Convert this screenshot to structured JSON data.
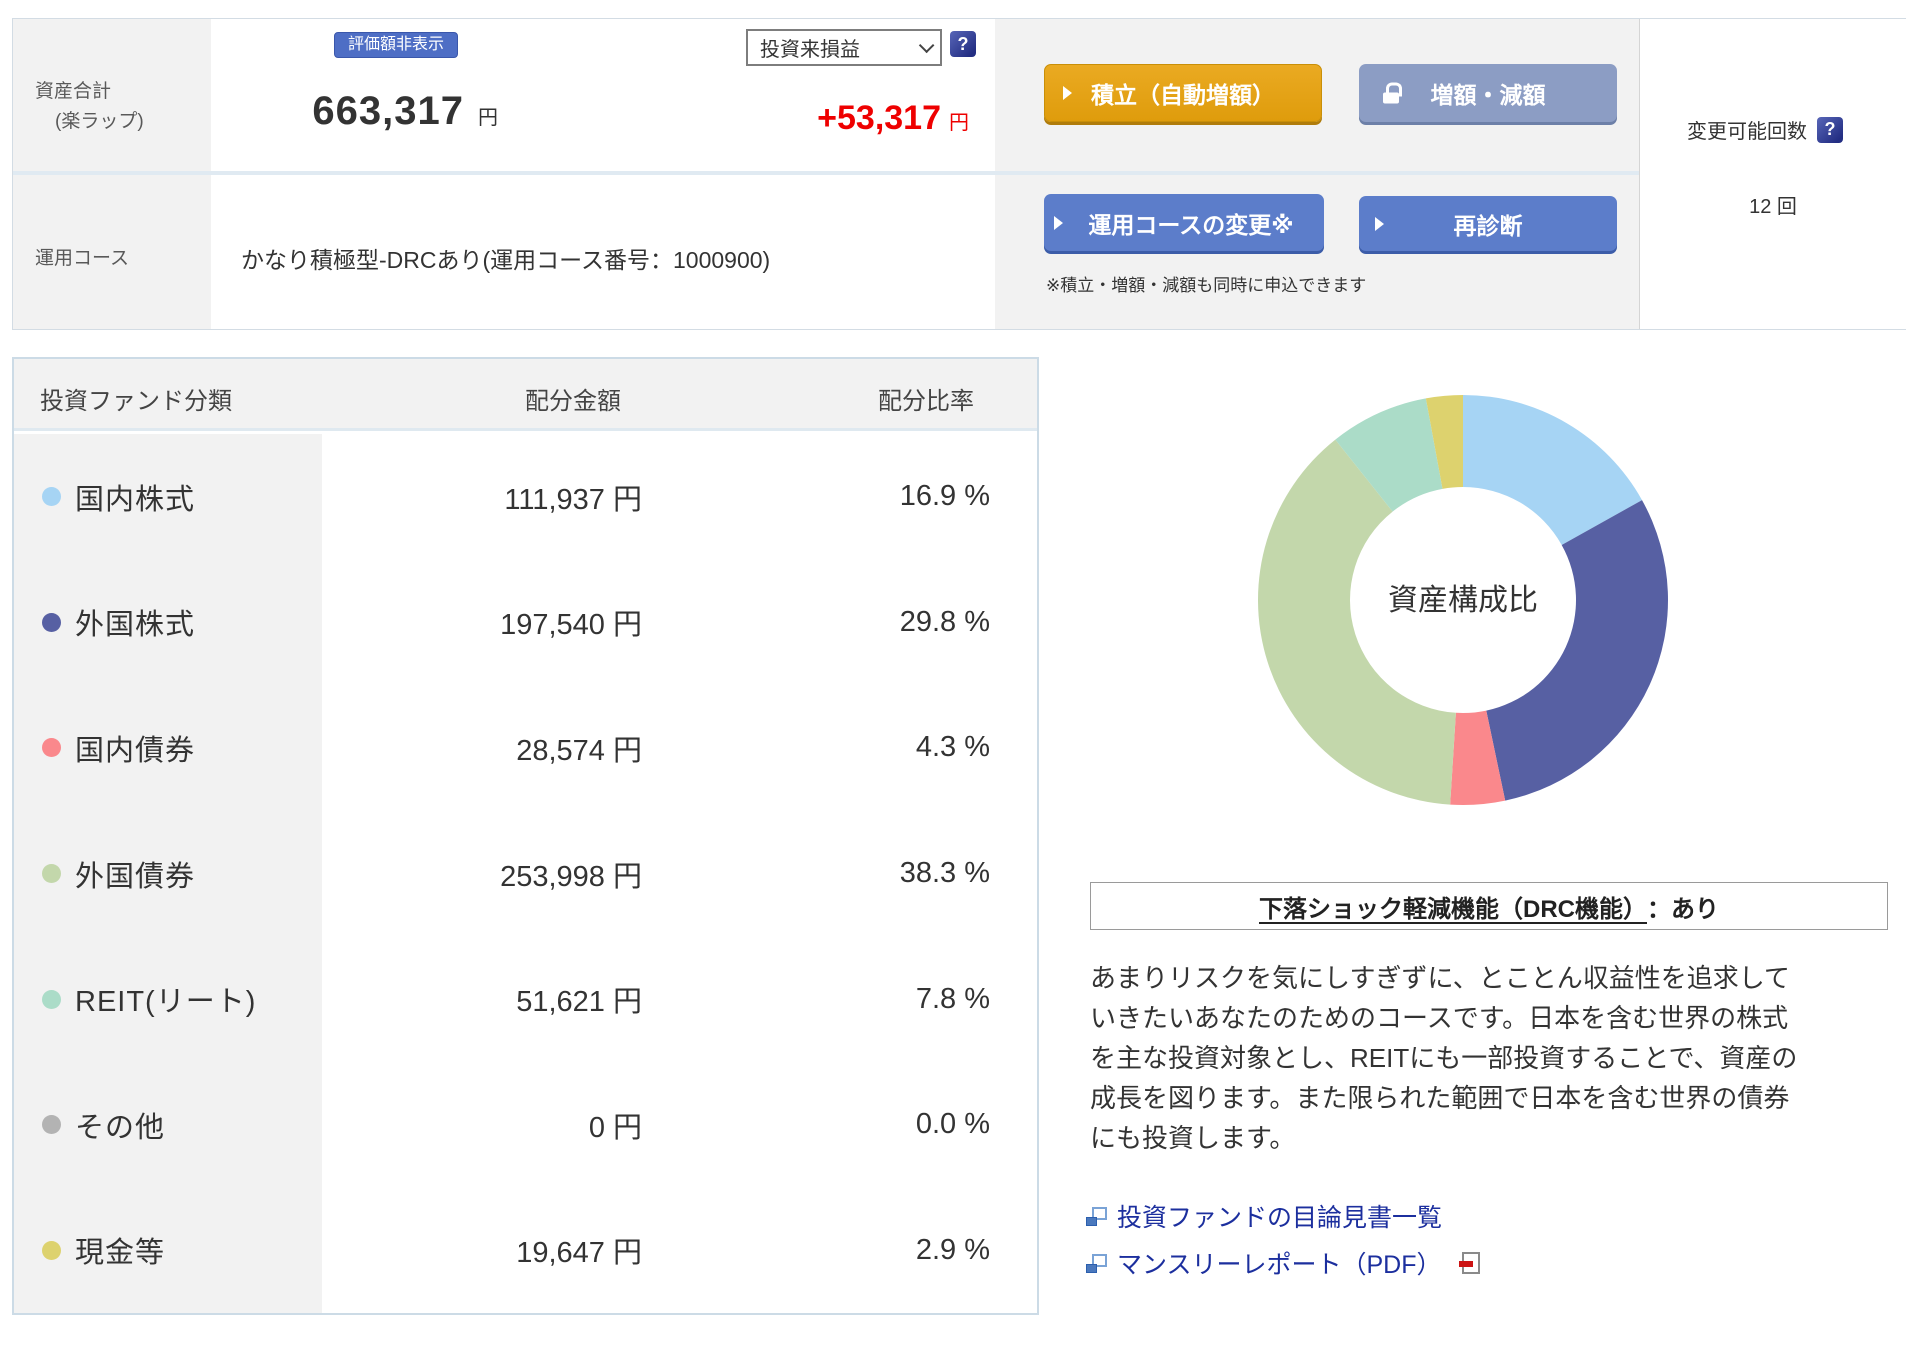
{
  "header": {
    "asset_total_label_line1": "資産合計",
    "asset_total_label_line2": "(楽ラップ)",
    "hide_value_button": "評価額非表示",
    "total_amount": "663,317",
    "total_unit": "円",
    "pl_dropdown_value": "投資来損益",
    "pl_amount": "+53,317",
    "pl_unit": "円",
    "help_icon_glyph": "?",
    "tsumitate_button": "積立（自動増額）",
    "zougaku_button": "増額・減額",
    "course_label": "運用コース",
    "course_value": "かなり積極型-DRCあり(運用コース番号：1000900)",
    "course_change_button": "運用コースの変更※",
    "rediagnosis_button": "再診断",
    "note": "※積立・増額・減額も同時に申込できます",
    "change_count_label": "変更可能回数",
    "change_count_value": "12 回"
  },
  "table": {
    "headers": {
      "category": "投資ファンド分類",
      "amount": "配分金額",
      "ratio": "配分比率"
    },
    "rows": [
      {
        "label": "国内株式",
        "amount": "111,937 円",
        "percent": "16.9 %",
        "color": "#a6d4f4"
      },
      {
        "label": "外国株式",
        "amount": "197,540 円",
        "percent": "29.8 %",
        "color": "#5760a3"
      },
      {
        "label": "国内債券",
        "amount": "28,574 円",
        "percent": "4.3 %",
        "color": "#fa888c"
      },
      {
        "label": "外国債券",
        "amount": "253,998 円",
        "percent": "38.3 %",
        "color": "#c3d7ab"
      },
      {
        "label": "REIT(リート)",
        "amount": "51,621 円",
        "percent": "7.8 %",
        "color": "#abdcc8"
      },
      {
        "label": "その他",
        "amount": "0 円",
        "percent": "0.0 %",
        "color": "#b3b3b3"
      },
      {
        "label": "現金等",
        "amount": "19,647 円",
        "percent": "2.9 %",
        "color": "#ddd26e"
      }
    ]
  },
  "chart_data": {
    "type": "pie",
    "title": "資産構成比",
    "labels": [
      "国内株式",
      "外国株式",
      "国内債券",
      "外国債券",
      "REIT(リート)",
      "その他",
      "現金等"
    ],
    "values": [
      16.9,
      29.8,
      4.3,
      38.3,
      7.8,
      0.0,
      2.9
    ],
    "colors": [
      "#a6d4f4",
      "#5760a3",
      "#fa888c",
      "#c3d7ab",
      "#abdcc8",
      "#b3b3b3",
      "#ddd26e"
    ],
    "start_angle_deg": -90,
    "direction": "clockwise",
    "outer_radius": 205,
    "inner_radius": 113,
    "legend_position": "none"
  },
  "course_info": {
    "drc_title_underlined": "下落ショック軽減機能（DRC機能）",
    "drc_value": "：あり",
    "description_lines": [
      "あまりリスクを気にしすぎずに、とことん収益性を追求して",
      "いきたいあなたのためのコースです。日本を含む世界の株式",
      "を主な投資対象とし、REITにも一部投資することで、資産の",
      "成長を図ります。また限られた範囲で日本を含む世界の債券",
      "にも投資します。"
    ],
    "links": [
      {
        "text": "投資ファンドの目論見書一覧"
      },
      {
        "text": "マンスリーレポート（PDF）"
      }
    ]
  },
  "colors": {
    "badge_blue": "#4e6ec5",
    "accent_orange": "#e3a11a",
    "locked_button_gray": "#8c9dc4",
    "primary_button_blue": "#5c7dca",
    "loss_gain_red": "#ee0000",
    "link_navy": "#1c2f9e",
    "panel_gray": "#f2f2f2"
  }
}
